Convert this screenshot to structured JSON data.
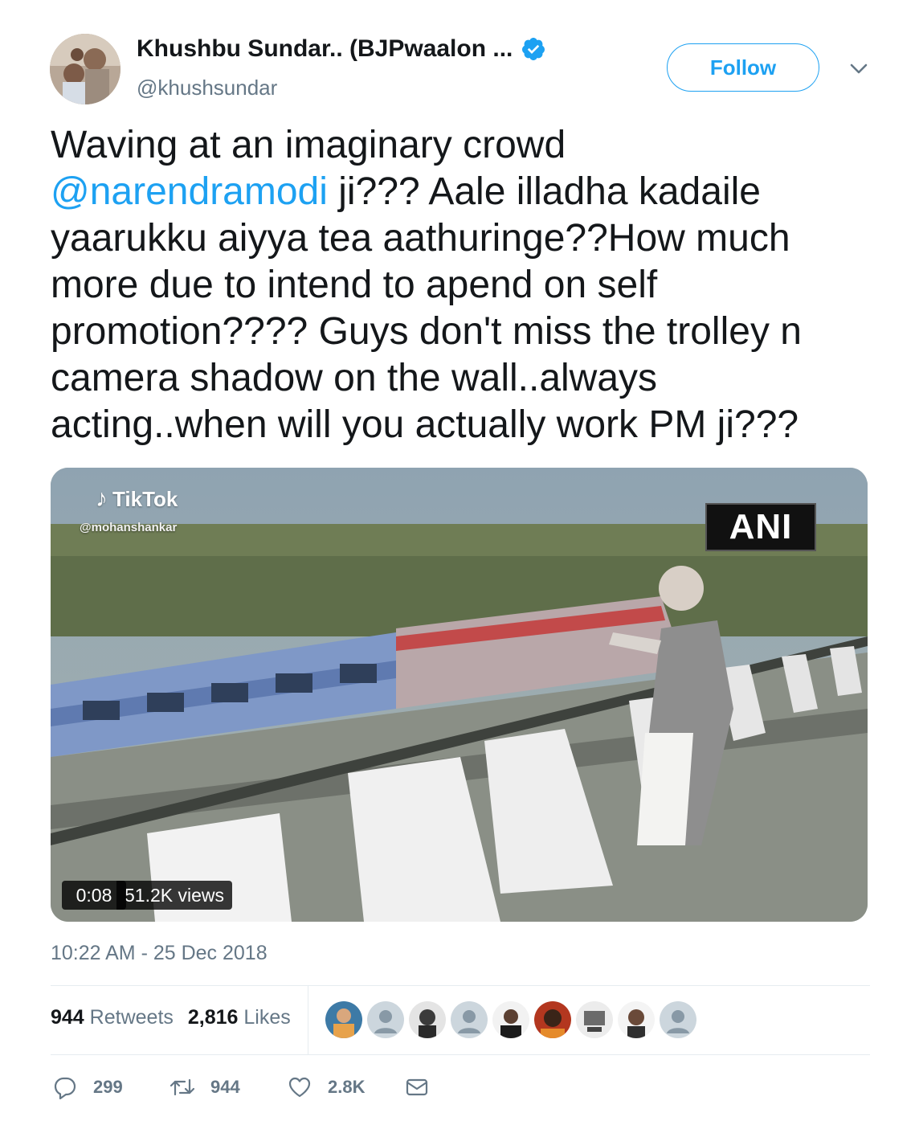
{
  "author": {
    "display_name": "Khushbu Sundar.. (BJPwaalon ...",
    "handle": "@khushsundar",
    "verified": true
  },
  "follow_label": "Follow",
  "tweet": {
    "lines": [
      {
        "text": "Waving at an imaginary crowd"
      },
      {
        "mention": "@narendramodi",
        "text": " ji??? Aale illadha kadaile"
      },
      {
        "text": "yaarukku aiyya tea aathuringe??How much"
      },
      {
        "text": "more due to intend to apend on self"
      },
      {
        "text": "promotion???? Guys don't miss the trolley n"
      },
      {
        "text": "camera shadow on the wall..always"
      },
      {
        "text": "acting..when will you actually work PM ji???"
      }
    ]
  },
  "media": {
    "watermark_brand": "TikTok",
    "watermark_user": "@mohanshankar",
    "logo": "ANI",
    "duration": "0:08",
    "views": "51.2K views"
  },
  "timestamp": "10:22 AM - 25 Dec 2018",
  "stats": {
    "retweets_count": "944",
    "retweets_label": "Retweets",
    "likes_count": "2,816",
    "likes_label": "Likes"
  },
  "actions": {
    "replies": "299",
    "retweets": "944",
    "likes": "2.8K"
  },
  "colors": {
    "accent": "#1da1f2",
    "secondary_text": "#657786",
    "primary_text": "#14171a",
    "divider": "#e6ecf0"
  },
  "icons": [
    "verified-badge-icon",
    "chevron-down-icon",
    "reply-icon",
    "retweet-icon",
    "heart-icon",
    "mail-icon"
  ]
}
